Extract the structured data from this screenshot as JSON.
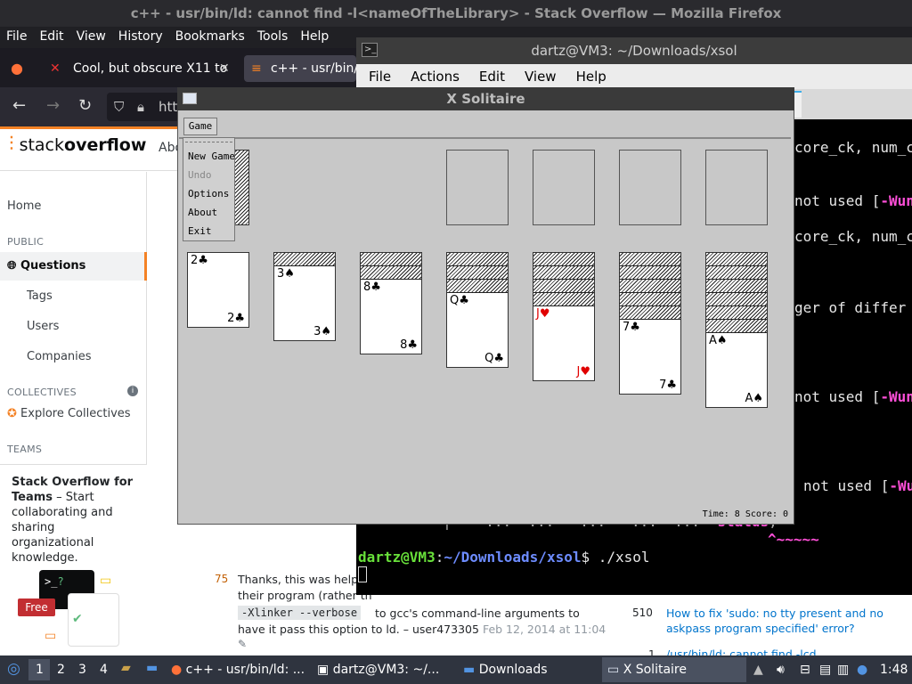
{
  "firefox": {
    "window_title": "c++ - usr/bin/ld: cannot find -l<nameOfTheLibrary> - Stack Overflow — Mozilla Firefox",
    "menu": [
      "File",
      "Edit",
      "View",
      "History",
      "Bookmarks",
      "Tools",
      "Help"
    ],
    "tabs": [
      {
        "label": "Cool, but obscure X11 to"
      },
      {
        "label": "c++ - usr/bin/l"
      }
    ],
    "url_partial": "htt"
  },
  "stackoverflow": {
    "logo_light": "stack",
    "logo_bold": "overflow",
    "about": "Abo",
    "nav": {
      "home": "Home",
      "public_heading": "PUBLIC",
      "questions": "Questions",
      "tags": "Tags",
      "users": "Users",
      "companies": "Companies",
      "collectives_heading": "COLLECTIVES",
      "explore_collectives": "Explore Collectives",
      "teams_heading": "TEAMS"
    },
    "teams_box": {
      "title": "Stack Overflow for Teams",
      "desc": " – Start collaborating and sharing organizational knowledge.",
      "badge": "Free"
    },
    "comment": {
      "score": "75",
      "line1": "Thanks, this was helpfu",
      "line2": "their program (rather th",
      "code": "-Xlinker --verbose",
      "line3": " to gcc's command-line arguments to",
      "line4": "have it pass this option to ld. – user473305",
      "date": "Feb 12, 2014 at 11:04"
    },
    "related": [
      {
        "score": "510",
        "title": "How to fix 'sudo: no tty present and no askpass program specified' error?"
      },
      {
        "score": "1",
        "title": "/usr/bin/ld: cannot find -lcd"
      }
    ]
  },
  "terminal": {
    "title": "dartz@VM3: ~/Downloads/xsol",
    "menu": [
      "File",
      "Actions",
      "Edit",
      "View",
      "Help"
    ],
    "lines": {
      "l1": "core_ck, num_c",
      "l2a": "not used [",
      "l2b": "-Wun",
      "l3": "core_ck, num_c",
      "l4": "ger of differ",
      "l5a": "not used [",
      "l5b": "-Wun",
      "l6a": "not used [",
      "l6b": "-Wu",
      "code_line": "        |    ...  ...   ...   ...  ...  ",
      "status_word": "status",
      "status_tail": ";",
      "carets": "^~~~~~"
    },
    "prompt_user": "dartz@VM3",
    "prompt_path": "~/Downloads/xsol",
    "prompt_cmd": "$ ./xsol"
  },
  "xsolitaire": {
    "title": "X Solitaire",
    "menu_button": "Game",
    "dropdown": {
      "new_game": "New Game",
      "undo": "Undo",
      "options": "Options",
      "about": "About",
      "exit": "Exit"
    },
    "status": "Time: 8 Score: 0",
    "tableau": [
      {
        "rank": "2",
        "suit": "♣",
        "color": "black",
        "hidden": 0
      },
      {
        "rank": "3",
        "suit": "♠",
        "color": "black",
        "hidden": 1
      },
      {
        "rank": "8",
        "suit": "♣",
        "color": "black",
        "hidden": 2
      },
      {
        "rank": "Q",
        "suit": "♣",
        "color": "black",
        "hidden": 3
      },
      {
        "rank": "J",
        "suit": "♥",
        "color": "red",
        "hidden": 4
      },
      {
        "rank": "7",
        "suit": "♣",
        "color": "black",
        "hidden": 5
      },
      {
        "rank": "A",
        "suit": "♠",
        "color": "black",
        "hidden": 6
      }
    ]
  },
  "taskbar": {
    "workspaces": [
      "1",
      "2",
      "3",
      "4"
    ],
    "apps": [
      {
        "label": "c++ - usr/bin/ld: ..."
      },
      {
        "label": "dartz@VM3: ~/..."
      },
      {
        "label": "Downloads"
      },
      {
        "label": "X Solitaire"
      }
    ],
    "clock": "1:48"
  }
}
